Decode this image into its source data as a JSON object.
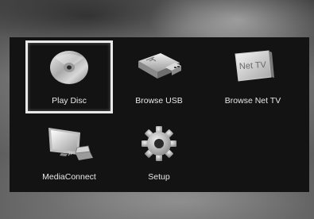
{
  "menu": {
    "items": [
      {
        "label": "Play Disc",
        "icon": "disc-icon",
        "selected": true
      },
      {
        "label": "Browse USB",
        "icon": "usb-drive-icon",
        "selected": false
      },
      {
        "label": "Browse Net TV",
        "icon": "net-tv-icon",
        "selected": false,
        "icon_text": "Net TV"
      },
      {
        "label": "MediaConnect",
        "icon": "monitor-laptop-icon",
        "selected": false
      },
      {
        "label": "Setup",
        "icon": "gear-icon",
        "selected": false
      }
    ]
  },
  "colors": {
    "panel": "#131313",
    "label": "#e8e8e8",
    "selection_border": "#e9e9e9"
  }
}
